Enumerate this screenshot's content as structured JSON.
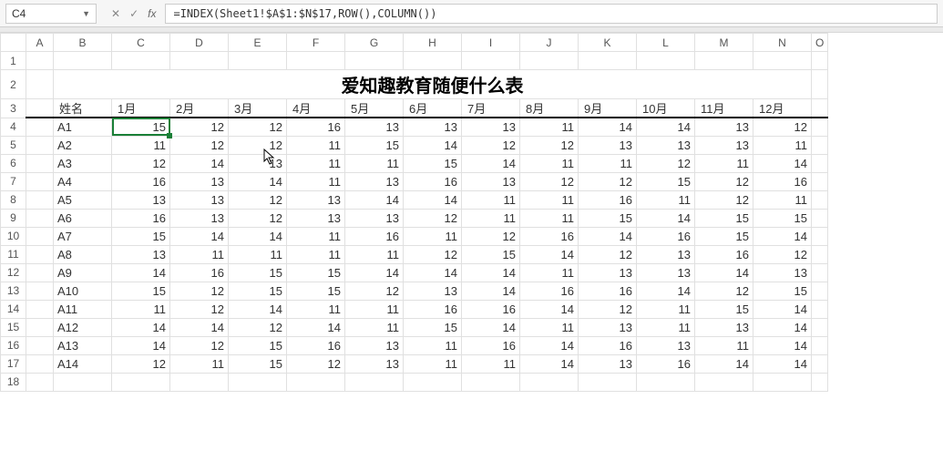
{
  "name_box": "C4",
  "formula": "=INDEX(Sheet1!$A$1:$N$17,ROW(),COLUMN())",
  "col_letters": [
    "A",
    "B",
    "C",
    "D",
    "E",
    "F",
    "G",
    "H",
    "I",
    "J",
    "K",
    "L",
    "M",
    "N",
    "O"
  ],
  "row_numbers": [
    "1",
    "2",
    "3",
    "4",
    "5",
    "6",
    "7",
    "8",
    "9",
    "10",
    "11",
    "12",
    "13",
    "14",
    "15",
    "16",
    "17",
    "18"
  ],
  "title": "爱知趣教育随便什么表",
  "header": {
    "name": "姓名",
    "months": [
      "1月",
      "2月",
      "3月",
      "4月",
      "5月",
      "6月",
      "7月",
      "8月",
      "9月",
      "10月",
      "11月",
      "12月"
    ]
  },
  "selected_cell": "C4",
  "chart_data": {
    "type": "table",
    "columns": [
      "姓名",
      "1月",
      "2月",
      "3月",
      "4月",
      "5月",
      "6月",
      "7月",
      "8月",
      "9月",
      "10月",
      "11月",
      "12月"
    ],
    "rows": [
      {
        "name": "A1",
        "values": [
          15,
          12,
          12,
          16,
          13,
          13,
          13,
          11,
          14,
          14,
          13,
          12
        ]
      },
      {
        "name": "A2",
        "values": [
          11,
          12,
          12,
          11,
          15,
          14,
          12,
          12,
          13,
          13,
          13,
          11
        ]
      },
      {
        "name": "A3",
        "values": [
          12,
          14,
          13,
          11,
          11,
          15,
          14,
          11,
          11,
          12,
          11,
          14
        ]
      },
      {
        "name": "A4",
        "values": [
          16,
          13,
          14,
          11,
          13,
          16,
          13,
          12,
          12,
          15,
          12,
          16
        ]
      },
      {
        "name": "A5",
        "values": [
          13,
          13,
          12,
          13,
          14,
          14,
          11,
          11,
          16,
          11,
          12,
          11
        ]
      },
      {
        "name": "A6",
        "values": [
          16,
          13,
          12,
          13,
          13,
          12,
          11,
          11,
          15,
          14,
          15,
          15
        ]
      },
      {
        "name": "A7",
        "values": [
          15,
          14,
          14,
          11,
          16,
          11,
          12,
          16,
          14,
          16,
          15,
          14
        ]
      },
      {
        "name": "A8",
        "values": [
          13,
          11,
          11,
          11,
          11,
          12,
          15,
          14,
          12,
          13,
          16,
          12
        ]
      },
      {
        "name": "A9",
        "values": [
          14,
          16,
          15,
          15,
          14,
          14,
          14,
          11,
          13,
          13,
          14,
          13
        ]
      },
      {
        "name": "A10",
        "values": [
          15,
          12,
          15,
          15,
          12,
          13,
          14,
          16,
          16,
          14,
          12,
          15
        ]
      },
      {
        "name": "A11",
        "values": [
          11,
          12,
          14,
          11,
          11,
          16,
          16,
          14,
          12,
          11,
          15,
          14
        ]
      },
      {
        "name": "A12",
        "values": [
          14,
          14,
          12,
          14,
          11,
          15,
          14,
          11,
          13,
          11,
          13,
          14
        ]
      },
      {
        "name": "A13",
        "values": [
          14,
          12,
          15,
          16,
          13,
          11,
          16,
          14,
          16,
          13,
          11,
          14
        ]
      },
      {
        "name": "A14",
        "values": [
          12,
          11,
          15,
          12,
          13,
          11,
          11,
          14,
          13,
          16,
          14,
          14
        ]
      }
    ]
  }
}
